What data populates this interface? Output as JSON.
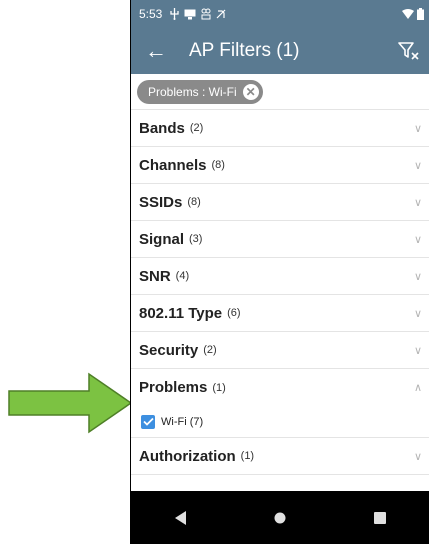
{
  "status": {
    "time": "5:53",
    "notification_icons": [
      "usb-icon",
      "cast-icon",
      "battery-saver-icon",
      "no-sim-icon"
    ]
  },
  "appbar": {
    "title": "AP Filters (1)"
  },
  "active_filter_chip": {
    "label": "Problems : Wi-Fi"
  },
  "filters": [
    {
      "name": "Bands",
      "count": "(2)",
      "expanded": false
    },
    {
      "name": "Channels",
      "count": "(8)",
      "expanded": false
    },
    {
      "name": "SSIDs",
      "count": "(8)",
      "expanded": false
    },
    {
      "name": "Signal",
      "count": "(3)",
      "expanded": false
    },
    {
      "name": "SNR",
      "count": "(4)",
      "expanded": false
    },
    {
      "name": "802.11 Type",
      "count": "(6)",
      "expanded": false
    },
    {
      "name": "Security",
      "count": "(2)",
      "expanded": false
    },
    {
      "name": "Problems",
      "count": "(1)",
      "expanded": true,
      "options": [
        {
          "label": "Wi-Fi (7)",
          "checked": true
        }
      ]
    },
    {
      "name": "Authorization",
      "count": "(1)",
      "expanded": false
    }
  ],
  "colors": {
    "appbar": "#5a7a91",
    "chip": "#8a8a8a",
    "checkbox": "#3d8fe0",
    "annotation_arrow": "#7cc242"
  }
}
